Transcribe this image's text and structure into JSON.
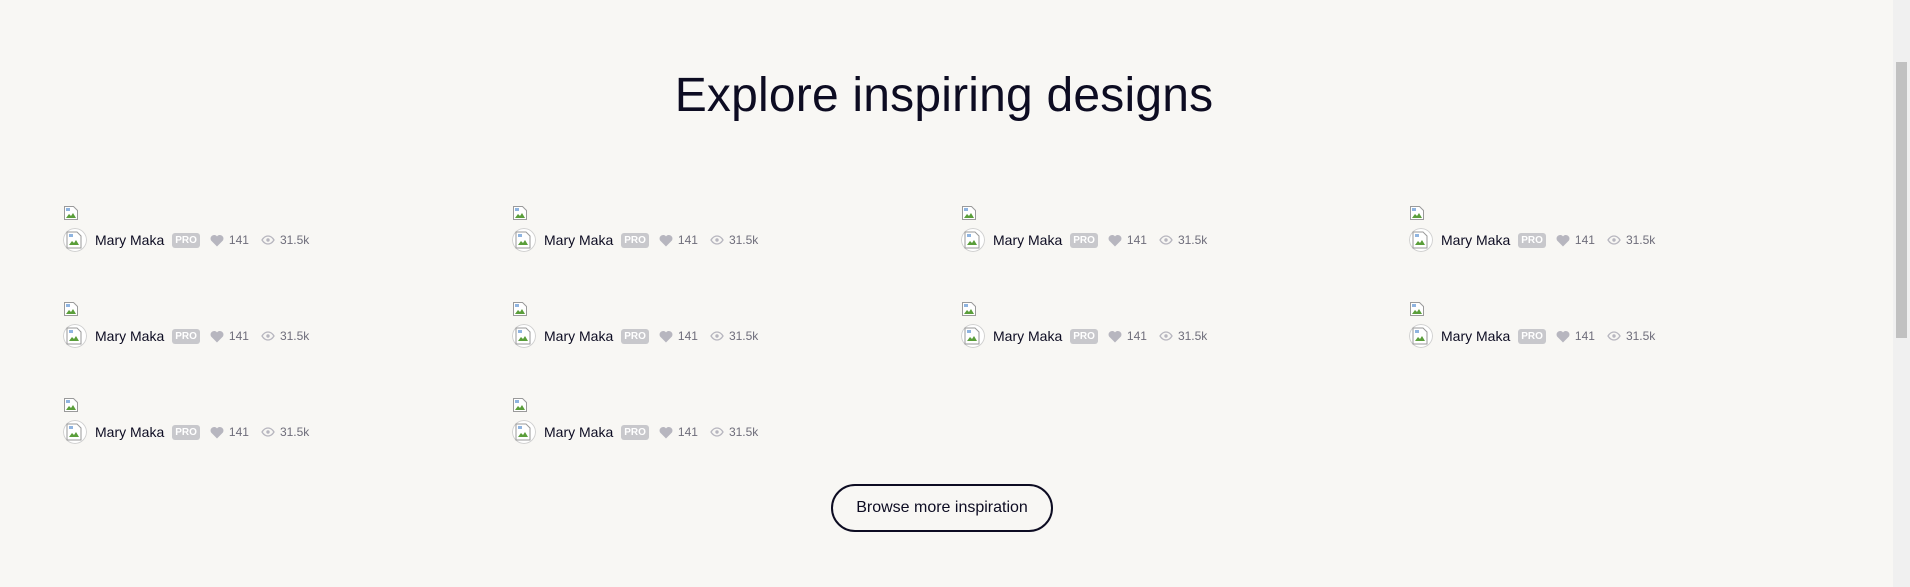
{
  "heading": "Explore inspiring designs",
  "shots": [
    {
      "author": "Mary Maka",
      "badge": "PRO",
      "likes": "141",
      "views": "31.5k"
    },
    {
      "author": "Mary Maka",
      "badge": "PRO",
      "likes": "141",
      "views": "31.5k"
    },
    {
      "author": "Mary Maka",
      "badge": "PRO",
      "likes": "141",
      "views": "31.5k"
    },
    {
      "author": "Mary Maka",
      "badge": "PRO",
      "likes": "141",
      "views": "31.5k"
    },
    {
      "author": "Mary Maka",
      "badge": "PRO",
      "likes": "141",
      "views": "31.5k"
    },
    {
      "author": "Mary Maka",
      "badge": "PRO",
      "likes": "141",
      "views": "31.5k"
    },
    {
      "author": "Mary Maka",
      "badge": "PRO",
      "likes": "141",
      "views": "31.5k"
    },
    {
      "author": "Mary Maka",
      "badge": "PRO",
      "likes": "141",
      "views": "31.5k"
    },
    {
      "author": "Mary Maka",
      "badge": "PRO",
      "likes": "141",
      "views": "31.5k"
    },
    {
      "author": "Mary Maka",
      "badge": "PRO",
      "likes": "141",
      "views": "31.5k"
    }
  ],
  "browse_button": "Browse more inspiration",
  "icons": {
    "thumbnail": "broken-image-icon",
    "likes": "heart-icon",
    "views": "eye-icon"
  },
  "colors": {
    "background": "#f8f7f4",
    "text": "#0d0c22",
    "pro_badge": "#c8c8cc",
    "stat_icon": "#b7b6bf"
  }
}
